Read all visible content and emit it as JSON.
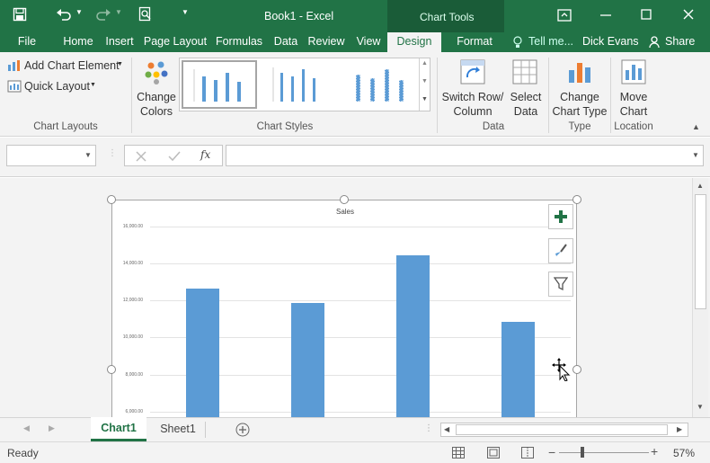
{
  "window": {
    "title": "Book1 - Excel",
    "context_tab": "Chart Tools",
    "user": "Dick Evans",
    "share": "Share",
    "tell_me": "Tell me..."
  },
  "tabs": [
    {
      "label": "File"
    },
    {
      "label": "Home"
    },
    {
      "label": "Insert"
    },
    {
      "label": "Page Layout"
    },
    {
      "label": "Formulas"
    },
    {
      "label": "Data"
    },
    {
      "label": "Review"
    },
    {
      "label": "View"
    },
    {
      "label": "Design",
      "active": true
    },
    {
      "label": "Format"
    }
  ],
  "ribbon": {
    "add_chart_element": "Add Chart Element",
    "quick_layout": "Quick Layout",
    "change_colors_1": "Change",
    "change_colors_2": "Colors",
    "switch_row_1": "Switch Row/",
    "switch_row_2": "Column",
    "select_data_1": "Select",
    "select_data_2": "Data",
    "change_type_1": "Change",
    "change_type_2": "Chart Type",
    "move_chart_1": "Move",
    "move_chart_2": "Chart",
    "groups": {
      "chart_layouts": "Chart Layouts",
      "chart_styles": "Chart Styles",
      "data": "Data",
      "type": "Type",
      "location": "Location"
    }
  },
  "formula_bar": {
    "name_box": "",
    "fx": "fx",
    "formula": ""
  },
  "chart_data": {
    "type": "bar",
    "title": "Sales",
    "categories": [
      "",
      "",
      "",
      ""
    ],
    "values": [
      12650,
      11880,
      14450,
      10820
    ],
    "ylim": [
      6000,
      16000
    ],
    "yticks": [
      "6,000.00",
      "8,000.00",
      "10,000.00",
      "12,000.00",
      "14,000.00",
      "16,000.00"
    ],
    "grid": true,
    "color": "#5b9bd5"
  },
  "sheets": [
    {
      "name": "Chart1",
      "active": true
    },
    {
      "name": "Sheet1"
    }
  ],
  "status": {
    "mode": "Ready",
    "zoom": "57%"
  },
  "colors": {
    "accent": "#217346",
    "bar": "#5b9bd5"
  }
}
